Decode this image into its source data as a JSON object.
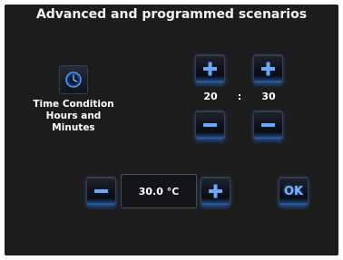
{
  "screen": {
    "title": "Advanced and programmed scenarios",
    "time_condition": {
      "icon": "clock-icon",
      "label_line1": "Time Condition",
      "label_line2": "Hours and Minutes",
      "hours": "20",
      "separator": ":",
      "minutes": "30"
    },
    "temperature": {
      "value": "30.0 °C"
    },
    "ok_label": "OK",
    "colors": {
      "background": "#1c1c1c",
      "accent": "#2a6fd0",
      "glyph": "#6aa8ff"
    }
  }
}
